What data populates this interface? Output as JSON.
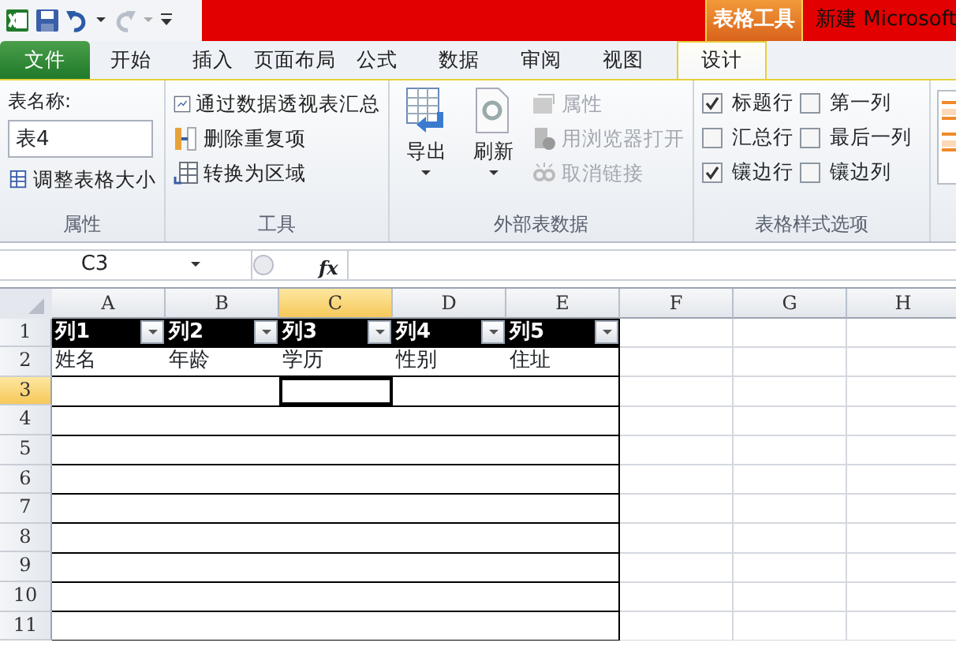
{
  "title_bar": {
    "contextual_label": "表格工具",
    "title": "新建 Microsoft"
  },
  "tabs": [
    {
      "label": "文件",
      "kind": "file",
      "selected": false
    },
    {
      "label": "开始",
      "kind": "tab",
      "selected": false
    },
    {
      "label": "插入",
      "kind": "tab",
      "selected": false
    },
    {
      "label": "页面布局",
      "kind": "tab",
      "selected": false
    },
    {
      "label": "公式",
      "kind": "tab",
      "selected": false
    },
    {
      "label": "数据",
      "kind": "tab",
      "selected": false
    },
    {
      "label": "审阅",
      "kind": "tab",
      "selected": false
    },
    {
      "label": "视图",
      "kind": "tab",
      "selected": false
    },
    {
      "label": "设计",
      "kind": "contextual",
      "selected": true
    }
  ],
  "ribbon": {
    "properties": {
      "name_label": "表名称:",
      "table_name": "表4",
      "resize_button": "调整表格大小",
      "group_label": "属性"
    },
    "tools": {
      "buttons": [
        "通过数据透视表汇总",
        "删除重复项",
        "转换为区域"
      ],
      "group_label": "工具"
    },
    "external": {
      "large_buttons": [
        {
          "label": "导出",
          "kind": "export"
        },
        {
          "label": "刷新",
          "kind": "refresh"
        }
      ],
      "small_buttons": [
        {
          "label": "属性",
          "kind": "properties",
          "disabled": true
        },
        {
          "label": "用浏览器打开",
          "kind": "browser",
          "disabled": true
        },
        {
          "label": "取消链接",
          "kind": "unlink",
          "disabled": true
        }
      ],
      "group_label": "外部表数据"
    },
    "style_options": {
      "checkboxes": [
        {
          "label": "标题行",
          "checked": true
        },
        {
          "label": "汇总行",
          "checked": false
        },
        {
          "label": "镶边行",
          "checked": true
        },
        {
          "label": "第一列",
          "checked": false
        },
        {
          "label": "最后一列",
          "checked": false
        },
        {
          "label": "镶边列",
          "checked": false
        }
      ],
      "group_label": "表格样式选项"
    }
  },
  "formula_bar": {
    "name_box": "C3",
    "function_label": "fx"
  },
  "sheet": {
    "columns": [
      {
        "label": "A",
        "selected": false
      },
      {
        "label": "B",
        "selected": false
      },
      {
        "label": "C",
        "selected": true
      },
      {
        "label": "D",
        "selected": false
      },
      {
        "label": "E",
        "selected": false
      },
      {
        "label": "F",
        "selected": false
      },
      {
        "label": "G",
        "selected": false
      },
      {
        "label": "H",
        "selected": false
      }
    ],
    "rows": [
      {
        "number": "1",
        "selected": false
      },
      {
        "number": "2",
        "selected": false
      },
      {
        "number": "3",
        "selected": true
      },
      {
        "number": "4",
        "selected": false
      },
      {
        "number": "5",
        "selected": false
      },
      {
        "number": "6",
        "selected": false
      },
      {
        "number": "7",
        "selected": false
      },
      {
        "number": "8",
        "selected": false
      },
      {
        "number": "9",
        "selected": false
      },
      {
        "number": "10",
        "selected": false
      },
      {
        "number": "11",
        "selected": false
      }
    ],
    "table": {
      "headers": [
        "列1",
        "列2",
        "列3",
        "列4",
        "列5"
      ],
      "rows": [
        [
          "姓名",
          "年龄",
          "学历",
          "性别",
          "住址"
        ]
      ]
    }
  }
}
